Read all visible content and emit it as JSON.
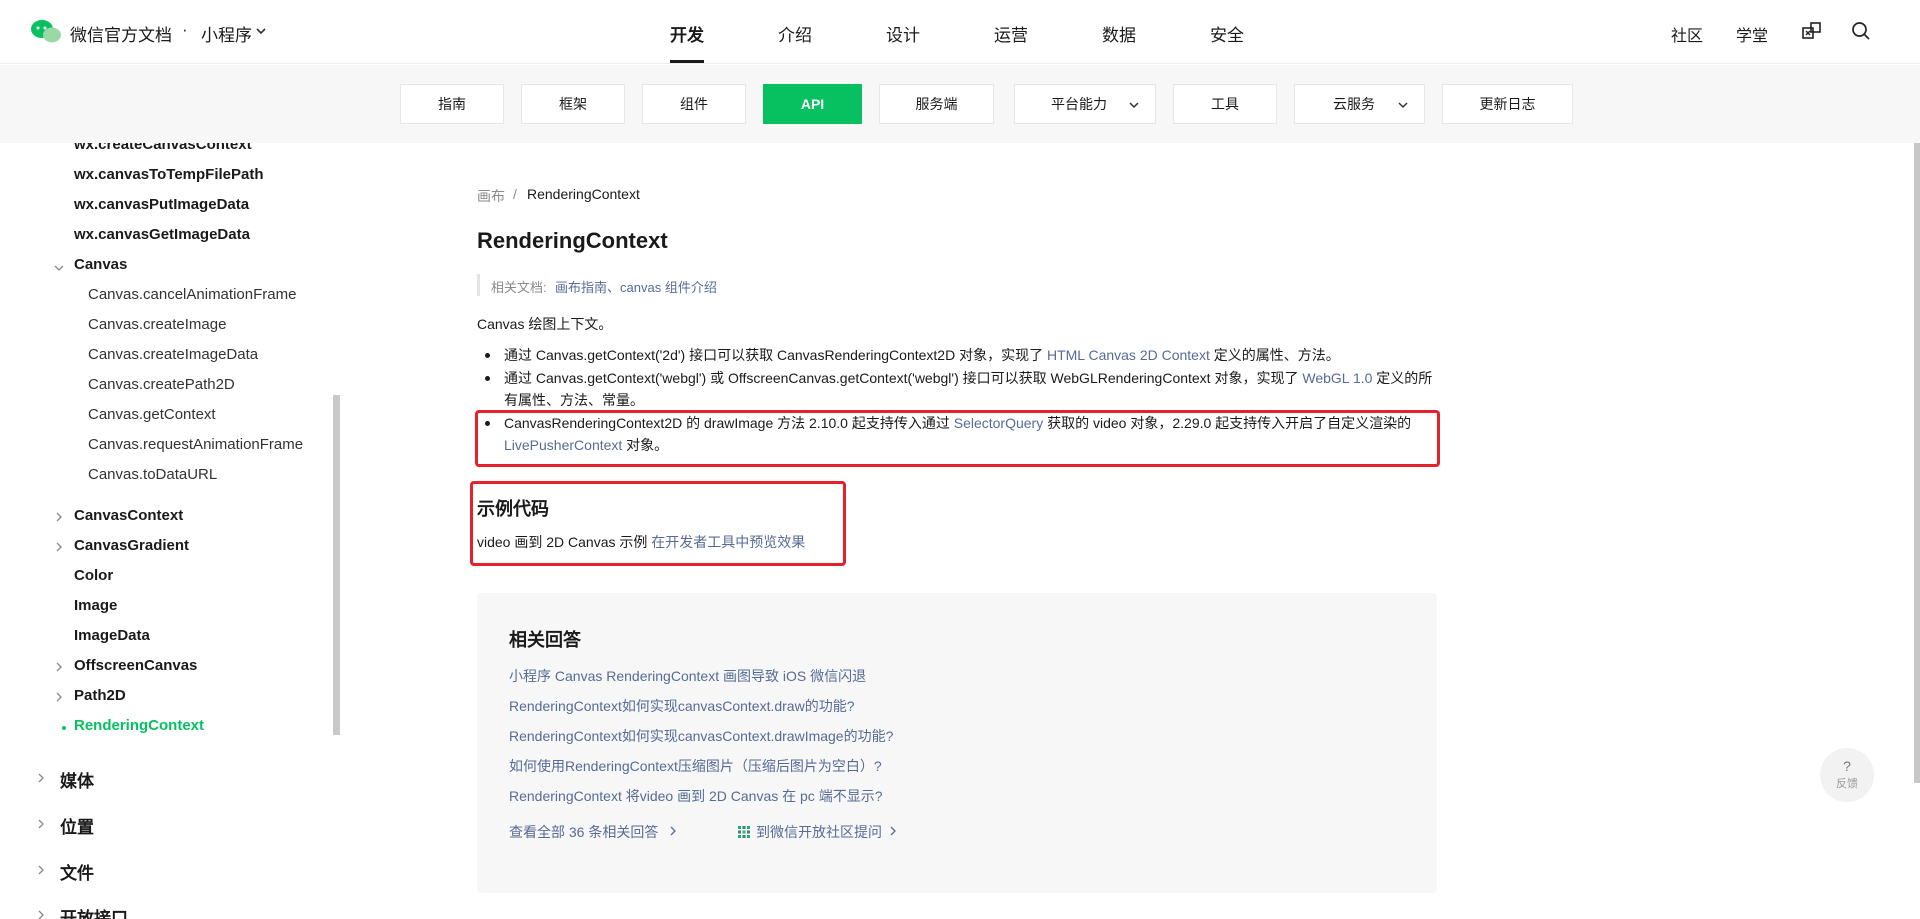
{
  "header": {
    "brand": "微信官方文档",
    "dot": "·",
    "product": "小程序",
    "nav": [
      "开发",
      "介绍",
      "设计",
      "运营",
      "数据",
      "安全"
    ],
    "right": [
      "社区",
      "学堂"
    ]
  },
  "subnav": [
    "指南",
    "框架",
    "组件",
    "API",
    "服务端",
    "平台能力",
    "工具",
    "云服务",
    "更新日志"
  ],
  "sidebar": {
    "items": [
      "wx.createCanvasContext",
      "wx.canvasToTempFilePath",
      "wx.canvasPutImageData",
      "wx.canvasGetImageData",
      "Canvas",
      "Canvas.cancelAnimationFrame",
      "Canvas.createImage",
      "Canvas.createImageData",
      "Canvas.createPath2D",
      "Canvas.getContext",
      "Canvas.requestAnimationFrame",
      "Canvas.toDataURL",
      "CanvasContext",
      "CanvasGradient",
      "Color",
      "Image",
      "ImageData",
      "OffscreenCanvas",
      "Path2D",
      "RenderingContext"
    ],
    "top_items": [
      "媒体",
      "位置",
      "文件",
      "开放接口"
    ]
  },
  "content": {
    "breadcrumb_parent": "画布",
    "breadcrumb_sep": "/",
    "breadcrumb_current": "RenderingContext",
    "title": "RenderingContext",
    "related_label": "相关文档:",
    "related_link1": "画布指南",
    "related_sep": "、",
    "related_link2": "canvas 组件介绍",
    "intro": "Canvas 绘图上下文。",
    "b1_text": "通过 Canvas.getContext('2d') 接口可以获取 CanvasRenderingContext2D 对象，实现了 ",
    "b1_link": "HTML Canvas 2D Context",
    "b1_tail": " 定义的属性、方法。",
    "b2_text": "通过 Canvas.getContext('webgl') 或 OffscreenCanvas.getContext('webgl') 接口可以获取 WebGLRenderingContext 对象，实现了 ",
    "b2_link": "WebGL 1.0",
    "b2_tail": " 定义的所有属性、方法、常量。",
    "b3_text": "CanvasRenderingContext2D 的 drawImage 方法 2.10.0 起支持传入通过 ",
    "b3_link1": "SelectorQuery",
    "b3_mid": " 获取的 video 对象，2.29.0 起支持传入开启了自定义渲染的 ",
    "b3_link2": "LivePusherContext",
    "b3_tail": " 对象。",
    "example_title": "示例代码",
    "example_text": "video 画到 2D Canvas 示例 ",
    "example_link": "在开发者工具中预览效果"
  },
  "answers": {
    "title": "相关回答",
    "items": [
      "小程序 Canvas RenderingContext 画图导致 iOS 微信闪退",
      "RenderingContext如何实现canvasContext.draw的功能?",
      "RenderingContext如何实现canvasContext.drawImage的功能?",
      "如何使用RenderingContext压缩图片（压缩后图片为空白）?",
      "RenderingContext 将video 画到 2D Canvas 在 pc 端不显示?"
    ],
    "more": "查看全部 36 条相关回答",
    "community": "到微信开放社区提问"
  },
  "feedback": {
    "icon": "?",
    "label": "反馈"
  },
  "colors": {
    "accent": "#07c160",
    "link": "#576b95",
    "highlight": "#e6212b"
  }
}
